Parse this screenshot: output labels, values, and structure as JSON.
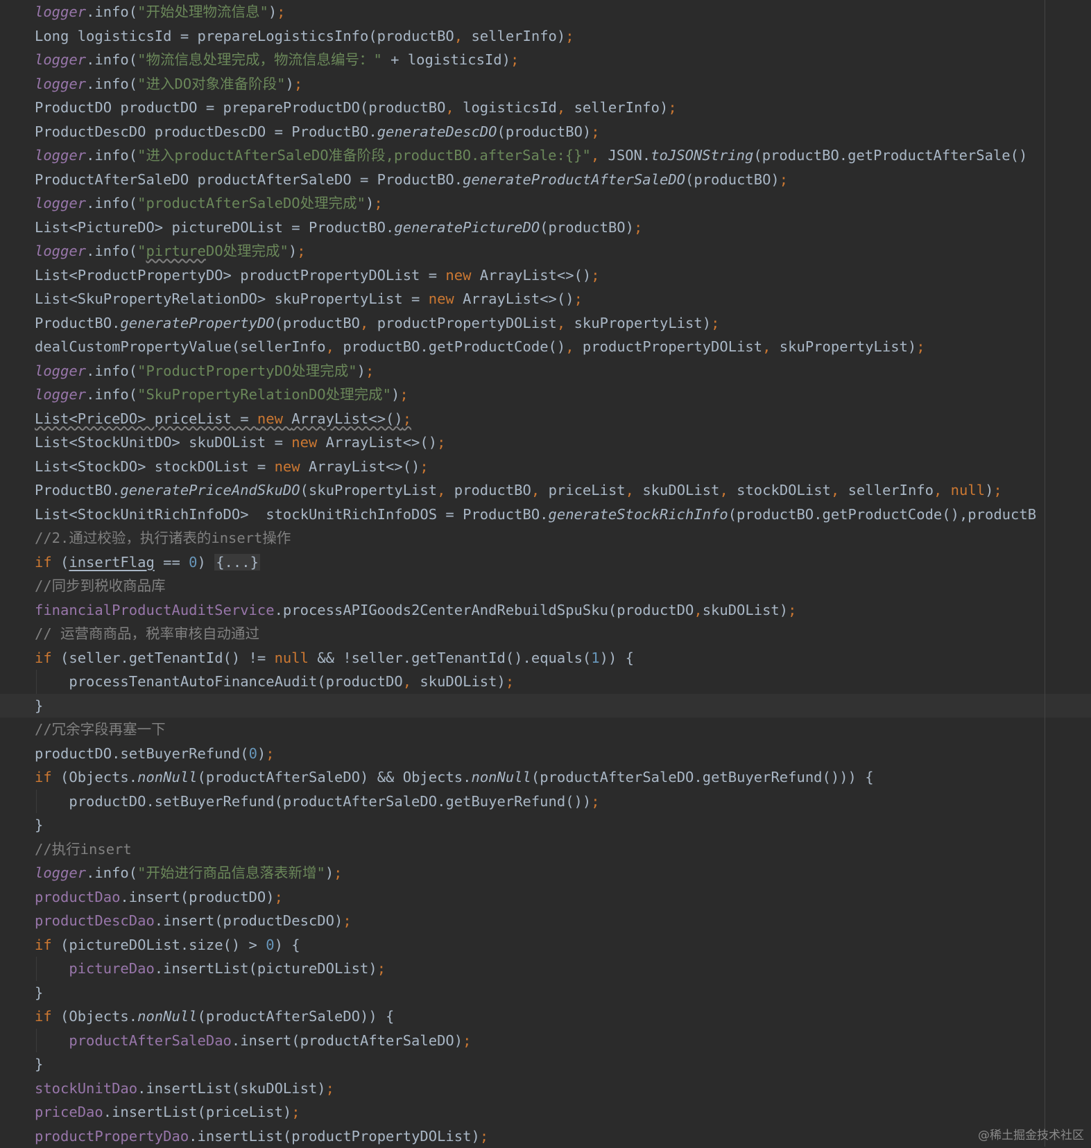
{
  "colors": {
    "background": "#2b2b2b",
    "text": "#a9b7c6",
    "keyword": "#cc7832",
    "string": "#6a8759",
    "field": "#9876aa",
    "number": "#6897bb",
    "comment": "#808080"
  },
  "watermark": "@稀土掘金技术社区",
  "current_line": 29,
  "code": {
    "lines": [
      {
        "t": [
          [
            "l",
            "logger"
          ],
          [
            "p",
            ".info("
          ],
          [
            "s",
            "\"开始处理物流信息\""
          ],
          [
            "p",
            ")"
          ],
          [
            "k",
            ";"
          ]
        ]
      },
      {
        "t": [
          [
            "p",
            "Long logisticsId = prepareLogisticsInfo(productBO"
          ],
          [
            "k",
            ", "
          ],
          [
            "p",
            "sellerInfo)"
          ],
          [
            "k",
            ";"
          ]
        ]
      },
      {
        "t": [
          [
            "l",
            "logger"
          ],
          [
            "p",
            ".info("
          ],
          [
            "s",
            "\"物流信息处理完成，物流信息编号：\""
          ],
          [
            "p",
            " + logisticsId)"
          ],
          [
            "k",
            ";"
          ]
        ]
      },
      {
        "t": [
          [
            "l",
            "logger"
          ],
          [
            "p",
            ".info("
          ],
          [
            "s",
            "\"进入DO对象准备阶段\""
          ],
          [
            "p",
            ")"
          ],
          [
            "k",
            ";"
          ]
        ]
      },
      {
        "t": [
          [
            "p",
            "ProductDO productDO = prepareProductDO(productBO"
          ],
          [
            "k",
            ", "
          ],
          [
            "p",
            "logisticsId"
          ],
          [
            "k",
            ", "
          ],
          [
            "p",
            "sellerInfo)"
          ],
          [
            "k",
            ";"
          ]
        ]
      },
      {
        "t": [
          [
            "p",
            "ProductDescDO productDescDO = ProductBO."
          ],
          [
            "i",
            "generateDescDO"
          ],
          [
            "p",
            "(productBO)"
          ],
          [
            "k",
            ";"
          ]
        ]
      },
      {
        "t": [
          [
            "l",
            "logger"
          ],
          [
            "p",
            ".info("
          ],
          [
            "s",
            "\"进入productAfterSaleDO准备阶段,productBO.afterSale:{}\""
          ],
          [
            "k",
            ", "
          ],
          [
            "p",
            "JSON."
          ],
          [
            "i",
            "toJSONString"
          ],
          [
            "p",
            "(productBO.getProductAfterSale()"
          ]
        ]
      },
      {
        "t": [
          [
            "p",
            "ProductAfterSaleDO productAfterSaleDO = ProductBO."
          ],
          [
            "i",
            "generateProductAfterSaleDO"
          ],
          [
            "p",
            "(productBO)"
          ],
          [
            "k",
            ";"
          ]
        ]
      },
      {
        "t": [
          [
            "l",
            "logger"
          ],
          [
            "p",
            ".info("
          ],
          [
            "s",
            "\"productAfterSaleDO处理完成\""
          ],
          [
            "p",
            ")"
          ],
          [
            "k",
            ";"
          ]
        ]
      },
      {
        "t": [
          [
            "p",
            "List<PictureDO> pictureDOList = ProductBO."
          ],
          [
            "i",
            "generatePictureDO"
          ],
          [
            "p",
            "(productBO)"
          ],
          [
            "k",
            ";"
          ]
        ]
      },
      {
        "t": [
          [
            "l",
            "logger"
          ],
          [
            "p",
            ".info("
          ],
          [
            "s",
            "\""
          ],
          [
            "s w",
            "pirture"
          ],
          [
            "s",
            "DO处理完成\""
          ],
          [
            "p",
            ")"
          ],
          [
            "k",
            ";"
          ]
        ]
      },
      {
        "t": [
          [
            "p",
            "List<ProductPropertyDO> productPropertyDOList = "
          ],
          [
            "k",
            "new "
          ],
          [
            "p",
            "ArrayList<>()"
          ],
          [
            "k",
            ";"
          ]
        ]
      },
      {
        "t": [
          [
            "p",
            "List<SkuPropertyRelationDO> skuPropertyList = "
          ],
          [
            "k",
            "new "
          ],
          [
            "p",
            "ArrayList<>()"
          ],
          [
            "k",
            ";"
          ]
        ]
      },
      {
        "t": [
          [
            "p",
            "ProductBO."
          ],
          [
            "i",
            "generatePropertyDO"
          ],
          [
            "p",
            "(productBO"
          ],
          [
            "k",
            ", "
          ],
          [
            "p",
            "productPropertyDOList"
          ],
          [
            "k",
            ", "
          ],
          [
            "p",
            "skuPropertyList)"
          ],
          [
            "k",
            ";"
          ]
        ]
      },
      {
        "t": [
          [
            "p",
            "dealCustomPropertyValue(sellerInfo"
          ],
          [
            "k",
            ", "
          ],
          [
            "p",
            "productBO.getProductCode()"
          ],
          [
            "k",
            ", "
          ],
          [
            "p",
            "productPropertyDOList"
          ],
          [
            "k",
            ", "
          ],
          [
            "p",
            "skuPropertyList)"
          ],
          [
            "k",
            ";"
          ]
        ]
      },
      {
        "t": [
          [
            "l",
            "logger"
          ],
          [
            "p",
            ".info("
          ],
          [
            "s",
            "\"ProductPropertyDO处理完成\""
          ],
          [
            "p",
            ")"
          ],
          [
            "k",
            ";"
          ]
        ]
      },
      {
        "t": [
          [
            "l",
            "logger"
          ],
          [
            "p",
            ".info("
          ],
          [
            "s",
            "\"SkuPropertyRelationDO处理完成\""
          ],
          [
            "p",
            ")"
          ],
          [
            "k",
            ";"
          ]
        ]
      },
      {
        "t": [
          [
            "p w",
            "List<PriceDO> priceList = "
          ],
          [
            "k w",
            "new "
          ],
          [
            "p w",
            "ArrayList<>()"
          ],
          [
            "k w",
            ";"
          ]
        ]
      },
      {
        "t": [
          [
            "p",
            "List<StockUnitDO> skuDOList = "
          ],
          [
            "k",
            "new "
          ],
          [
            "p",
            "ArrayList<>()"
          ],
          [
            "k",
            ";"
          ]
        ]
      },
      {
        "t": [
          [
            "p",
            "List<StockDO> stockDOList = "
          ],
          [
            "k",
            "new "
          ],
          [
            "p",
            "ArrayList<>()"
          ],
          [
            "k",
            ";"
          ]
        ]
      },
      {
        "t": [
          [
            "p",
            "ProductBO."
          ],
          [
            "i",
            "generatePriceAndSkuDO"
          ],
          [
            "p",
            "(skuPropertyList"
          ],
          [
            "k",
            ", "
          ],
          [
            "p",
            "productBO"
          ],
          [
            "k",
            ", "
          ],
          [
            "p",
            "priceList"
          ],
          [
            "k",
            ", "
          ],
          [
            "p",
            "skuDOList"
          ],
          [
            "k",
            ", "
          ],
          [
            "p",
            "stockDOList"
          ],
          [
            "k",
            ", "
          ],
          [
            "p",
            "sellerInfo"
          ],
          [
            "k",
            ", null"
          ],
          [
            "p",
            ")"
          ],
          [
            "k",
            ";"
          ]
        ]
      },
      {
        "t": [
          [
            "p",
            "List<StockUnitRichInfoDO>  stockUnitRichInfoDOS = ProductBO."
          ],
          [
            "i",
            "generateStockRichInfo"
          ],
          [
            "p",
            "(productBO.getProductCode(),productB"
          ]
        ]
      },
      {
        "t": [
          [
            "c",
            "//2.通过校验，执行诸表的insert操作"
          ]
        ]
      },
      {
        "t": [
          [
            "k",
            "if "
          ],
          [
            "p",
            "("
          ],
          [
            "p u",
            "insertFlag"
          ],
          [
            "p",
            " == "
          ],
          [
            "n",
            "0"
          ],
          [
            "p",
            ") "
          ],
          [
            "fold",
            "{...}"
          ]
        ]
      },
      {
        "t": [
          [
            "c",
            "//同步到税收商品库"
          ]
        ]
      },
      {
        "t": [
          [
            "f",
            "financialProductAuditService"
          ],
          [
            "p",
            ".processAPIGoods2CenterAndRebuildSpuSku(productDO"
          ],
          [
            "k",
            ","
          ],
          [
            "p",
            "skuDOList)"
          ],
          [
            "k",
            ";"
          ]
        ]
      },
      {
        "t": [
          [
            "c",
            "// 运营商商品，税率审核自动通过"
          ]
        ]
      },
      {
        "t": [
          [
            "k",
            "if "
          ],
          [
            "p",
            "(seller.getTenantId() != "
          ],
          [
            "k",
            "null "
          ],
          [
            "p",
            "&& !seller.getTenantId().equals("
          ],
          [
            "n",
            "1"
          ],
          [
            "p",
            ")) {"
          ]
        ]
      },
      {
        "g": 1,
        "t": [
          [
            "p",
            "    processTenantAutoFinanceAudit(productDO"
          ],
          [
            "k",
            ", "
          ],
          [
            "p",
            "skuDOList)"
          ],
          [
            "k",
            ";"
          ]
        ]
      },
      {
        "t": [
          [
            "p",
            "}"
          ]
        ]
      },
      {
        "t": [
          [
            "c",
            "//冗余字段再塞一下"
          ]
        ]
      },
      {
        "t": [
          [
            "p",
            "productDO.setBuyerRefund("
          ],
          [
            "n",
            "0"
          ],
          [
            "p",
            ")"
          ],
          [
            "k",
            ";"
          ]
        ]
      },
      {
        "t": [
          [
            "k",
            "if "
          ],
          [
            "p",
            "(Objects."
          ],
          [
            "i",
            "nonNull"
          ],
          [
            "p",
            "(productAfterSaleDO) && Objects."
          ],
          [
            "i",
            "nonNull"
          ],
          [
            "p",
            "(productAfterSaleDO.getBuyerRefund())) {"
          ]
        ]
      },
      {
        "g": 1,
        "t": [
          [
            "p",
            "    productDO.setBuyerRefund(productAfterSaleDO.getBuyerRefund())"
          ],
          [
            "k",
            ";"
          ]
        ]
      },
      {
        "t": [
          [
            "p",
            "}"
          ]
        ]
      },
      {
        "t": [
          [
            "c",
            "//执行insert"
          ]
        ]
      },
      {
        "t": [
          [
            "l",
            "logger"
          ],
          [
            "p",
            ".info("
          ],
          [
            "s",
            "\"开始进行商品信息落表新增\""
          ],
          [
            "p",
            ")"
          ],
          [
            "k",
            ";"
          ]
        ]
      },
      {
        "t": [
          [
            "f",
            "productDao"
          ],
          [
            "p",
            ".insert(productDO)"
          ],
          [
            "k",
            ";"
          ]
        ]
      },
      {
        "t": [
          [
            "f",
            "productDescDao"
          ],
          [
            "p",
            ".insert(productDescDO)"
          ],
          [
            "k",
            ";"
          ]
        ]
      },
      {
        "t": [
          [
            "k",
            "if "
          ],
          [
            "p",
            "(pictureDOList.size() > "
          ],
          [
            "n",
            "0"
          ],
          [
            "p",
            ") {"
          ]
        ]
      },
      {
        "g": 1,
        "t": [
          [
            "p",
            "    "
          ],
          [
            "f",
            "pictureDao"
          ],
          [
            "p",
            ".insertList(pictureDOList)"
          ],
          [
            "k",
            ";"
          ]
        ]
      },
      {
        "t": [
          [
            "p",
            "}"
          ]
        ]
      },
      {
        "t": [
          [
            "k",
            "if "
          ],
          [
            "p",
            "(Objects."
          ],
          [
            "i",
            "nonNull"
          ],
          [
            "p",
            "(productAfterSaleDO)) {"
          ]
        ]
      },
      {
        "g": 1,
        "t": [
          [
            "p",
            "    "
          ],
          [
            "f",
            "productAfterSaleDao"
          ],
          [
            "p",
            ".insert(productAfterSaleDO)"
          ],
          [
            "k",
            ";"
          ]
        ]
      },
      {
        "t": [
          [
            "p",
            "}"
          ]
        ]
      },
      {
        "t": [
          [
            "f",
            "stockUnitDao"
          ],
          [
            "p",
            ".insertList(skuDOList)"
          ],
          [
            "k",
            ";"
          ]
        ]
      },
      {
        "t": [
          [
            "f",
            "priceDao"
          ],
          [
            "p",
            ".insertList(priceList)"
          ],
          [
            "k",
            ";"
          ]
        ]
      },
      {
        "t": [
          [
            "f",
            "productPropertyDao"
          ],
          [
            "p",
            ".insertList(productPropertyDOList)"
          ],
          [
            "k",
            ";"
          ]
        ]
      }
    ]
  }
}
